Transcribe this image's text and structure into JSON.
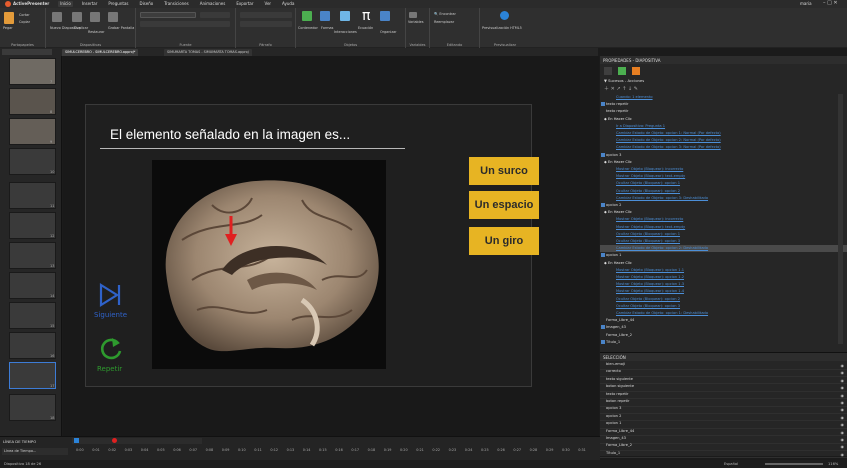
{
  "app": {
    "title": "ActivePresenter",
    "user": "maria",
    "menu": [
      "Inicio",
      "Insertar",
      "Preguntas",
      "Diseño",
      "Transiciones",
      "Animaciones",
      "Exportar",
      "Ver",
      "Ayuda"
    ],
    "active_menu": "Inicio"
  },
  "ribbon": {
    "groups": [
      {
        "label": "Portapapeles",
        "items": [
          "Pegar",
          "Cortar",
          "Copiar"
        ]
      },
      {
        "label": "Diapositivas",
        "items": [
          "Nuevo Diapositiva",
          "Duplicar",
          "Restaurar",
          "Grabar Pantalla"
        ]
      },
      {
        "label": "Fuente",
        "items": []
      },
      {
        "label": "Párrafo",
        "items": []
      },
      {
        "label": "Objetos",
        "items": [
          "Contenedor",
          "Formas",
          "Interacciones",
          "Ecuación",
          "Organizar"
        ]
      },
      {
        "label": "Variables",
        "items": [
          "Variables"
        ]
      },
      {
        "label": "Editando",
        "items": [
          "Encontrar",
          "Reemplazar"
        ]
      },
      {
        "label": "Previsualizar",
        "items": [
          "Previsualización HTML5"
        ]
      }
    ]
  },
  "doc_tabs": [
    "SIMULCEREBRO - SIMULCEREBRO.approj*",
    "SIMUMARTA TOMAS - SIMUMARTA TOMAS.approj"
  ],
  "thumbs": [
    {
      "num": "7"
    },
    {
      "num": "8"
    },
    {
      "num": "9"
    },
    {
      "num": "10"
    },
    {
      "num": "11"
    },
    {
      "num": "12"
    },
    {
      "num": "13"
    },
    {
      "num": "14"
    },
    {
      "num": "15"
    },
    {
      "num": "16"
    },
    {
      "num": "17"
    },
    {
      "num": "18"
    }
  ],
  "slide": {
    "question": "El elemento señalado en la imagen es...",
    "answers": [
      "Un surco",
      "Un espacio",
      "Un giro"
    ],
    "next_label": "Siguiente",
    "repeat_label": "Repetir",
    "colors": {
      "answer_bg": "#e7b423",
      "next": "#2f62c9",
      "repeat": "#2e9a2e",
      "arrow": "#e02020"
    }
  },
  "props": {
    "title": "PROPIEDADES - DIAPOSITIVA",
    "section": "Sucesos - Acciones",
    "rows": [
      {
        "t": "Cuando: 1 elemento",
        "k": "link",
        "i": 16
      },
      {
        "t": "texto repetir",
        "k": "obj",
        "i": 6
      },
      {
        "t": "texto repetir",
        "k": "plain",
        "i": 6
      },
      {
        "t": "En Hacer Clic",
        "k": "event",
        "i": 8
      },
      {
        "t": "Ir a Diapositiva: Pregunta 1",
        "k": "link",
        "i": 16
      },
      {
        "t": "Cambiar Estado de Objeto: opcion 1: Normal (Por defecto)",
        "k": "link",
        "i": 16
      },
      {
        "t": "Cambiar Estado de Objeto: opcion 2: Normal (Por defecto)",
        "k": "link",
        "i": 16
      },
      {
        "t": "Cambiar Estado de Objeto: opcion 3: Normal (Por defecto)",
        "k": "link",
        "i": 16
      },
      {
        "t": "opcion 3",
        "k": "obj",
        "i": 6
      },
      {
        "t": "En Hacer Clic",
        "k": "event",
        "i": 8
      },
      {
        "t": "Mostrar Objeto (Bloquear): incorrecto",
        "k": "link",
        "i": 16
      },
      {
        "t": "Mostrar Objeto (Bloquear): text-empty",
        "k": "link",
        "i": 16
      },
      {
        "t": "Ocultar Objeto (Bloquear): opcion 1",
        "k": "link",
        "i": 16
      },
      {
        "t": "Ocultar Objeto (Bloquear): opcion 2",
        "k": "link",
        "i": 16
      },
      {
        "t": "Cambiar Estado de Objeto: opcion 3: Deshabilitado",
        "k": "link",
        "i": 16
      },
      {
        "t": "opcion 2",
        "k": "obj",
        "i": 6
      },
      {
        "t": "En Hacer Clic",
        "k": "event",
        "i": 8
      },
      {
        "t": "Mostrar Objeto (Bloquear): incorrecto",
        "k": "link",
        "i": 16
      },
      {
        "t": "Mostrar Objeto (Bloquear): text-empty",
        "k": "link",
        "i": 16
      },
      {
        "t": "Ocultar Objeto (Bloquear): opcion 1",
        "k": "link",
        "i": 16
      },
      {
        "t": "Ocultar Objeto (Bloquear): opcion 3",
        "k": "link",
        "i": 16
      },
      {
        "t": "Cambiar Estado de Objeto: opcion 2: Deshabilitado",
        "k": "hl",
        "i": 16
      },
      {
        "t": "opcion 1",
        "k": "obj",
        "i": 6
      },
      {
        "t": "En Hacer Clic",
        "k": "event",
        "i": 8
      },
      {
        "t": "Mostrar Objeto (Bloquear): opcion 1.1",
        "k": "link",
        "i": 16
      },
      {
        "t": "Mostrar Objeto (Bloquear): opcion 1.2",
        "k": "link",
        "i": 16
      },
      {
        "t": "Mostrar Objeto (Bloquear): opcion 1.3",
        "k": "link",
        "i": 16
      },
      {
        "t": "Mostrar Objeto (Bloquear): opcion 1.4",
        "k": "link",
        "i": 16
      },
      {
        "t": "Ocultar Objeto (Bloquear): opcion 2",
        "k": "link",
        "i": 16
      },
      {
        "t": "Ocultar Objeto (Bloquear): opcion 3",
        "k": "link",
        "i": 16
      },
      {
        "t": "Cambiar Estado de Objeto: opcion 1: Deshabilitado",
        "k": "link",
        "i": 16
      },
      {
        "t": "Forma_Libre_44",
        "k": "plain",
        "i": 6
      },
      {
        "t": "Imagen_43",
        "k": "obj",
        "i": 6
      },
      {
        "t": "Forma_Libre_2",
        "k": "plain",
        "i": 6
      },
      {
        "t": "Título_1",
        "k": "obj",
        "i": 6
      }
    ]
  },
  "selection": {
    "title": "SELECCIÓN",
    "items": [
      "bien-emoji",
      "correcto",
      "texto siguiente",
      "boton siguiente",
      "texto repetir",
      "boton repetir",
      "opcion 3",
      "opcion 2",
      "opcion 1",
      "Forma_Libre_44",
      "Imagen_43",
      "Forma_Libre_2",
      "Título_1"
    ]
  },
  "timeline": {
    "title": "LÍNEA DE TIEMPO",
    "track_label": "Línea de Tiempo...",
    "ticks": [
      "0:00",
      "0:01",
      "0:02",
      "0:03",
      "0:04",
      "0:05",
      "0:06",
      "0:07",
      "0:08",
      "0:09",
      "0:10",
      "0:11",
      "0:12",
      "0:13",
      "0:14",
      "0:15",
      "0:16",
      "0:17",
      "0:18",
      "0:19",
      "0:20",
      "0:21",
      "0:22",
      "0:23",
      "0:24",
      "0:25",
      "0:26",
      "0:27",
      "0:28",
      "0:29",
      "0:30",
      "0:31"
    ]
  },
  "status": {
    "left": "Diapositiva 18 de 26",
    "lang": "Español",
    "zoom": "116%"
  }
}
